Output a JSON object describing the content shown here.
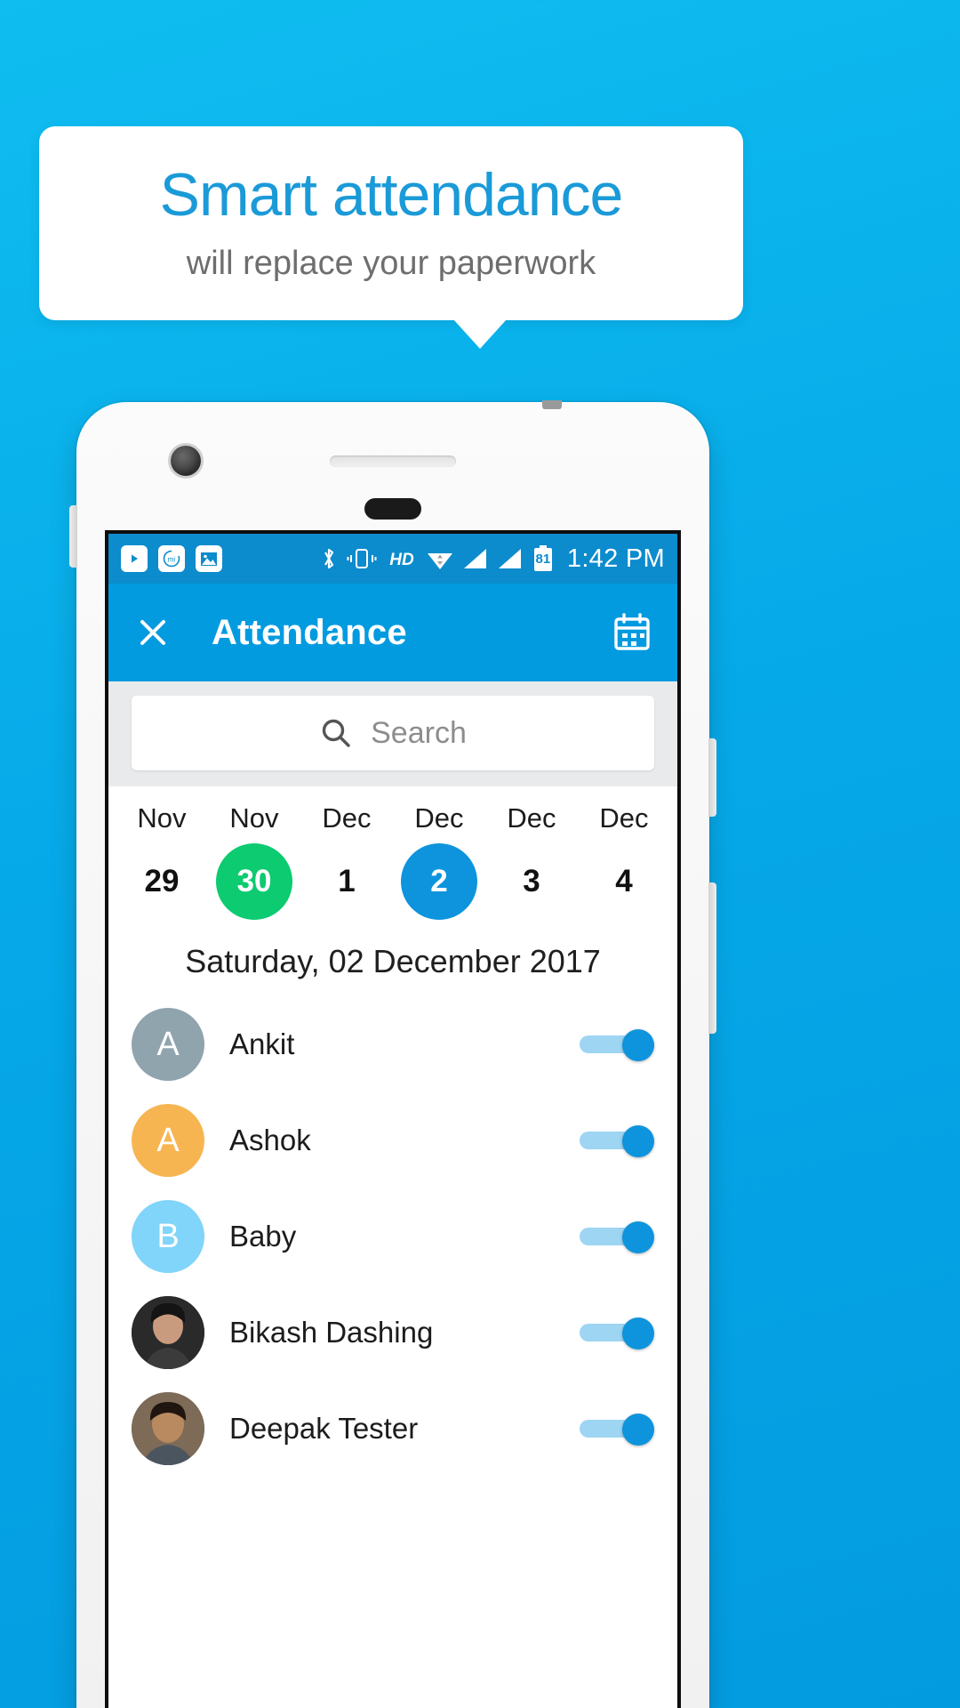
{
  "promo": {
    "title": "Smart attendance",
    "subtitle": "will replace your paperwork",
    "title_color": "#1b9ad8",
    "subtitle_color": "#6e6e6e",
    "background_color": "#06a9e8"
  },
  "statusbar": {
    "time": "1:42 PM",
    "battery_level": "81",
    "left_icons": [
      "youtube-play-icon",
      "mi-app-icon",
      "gallery-image-icon"
    ],
    "right_icons": [
      "bluetooth-icon",
      "vibrate-icon",
      "hd-icon",
      "wifi-icon",
      "signal-sim1-icon",
      "signal-sim2-icon",
      "battery-icon"
    ],
    "background_color": "#0c8bcd"
  },
  "appbar": {
    "title": "Attendance",
    "close_icon": "close-icon",
    "calendar_icon": "calendar-icon",
    "background_color": "#039be0"
  },
  "search": {
    "placeholder": "Search",
    "value": "",
    "icon": "search-icon"
  },
  "date_strip": [
    {
      "month": "Nov",
      "day": "29",
      "state": "normal"
    },
    {
      "month": "Nov",
      "day": "30",
      "state": "today"
    },
    {
      "month": "Dec",
      "day": "1",
      "state": "normal"
    },
    {
      "month": "Dec",
      "day": "2",
      "state": "selected"
    },
    {
      "month": "Dec",
      "day": "3",
      "state": "normal"
    },
    {
      "month": "Dec",
      "day": "4",
      "state": "normal"
    }
  ],
  "date_colors": {
    "today": "#0ccb70",
    "selected": "#0d94dd"
  },
  "selected_day_label": "Saturday, 02 December 2017",
  "attendance": [
    {
      "name": "Ankit",
      "initial": "A",
      "avatar_color": "#90a4ae",
      "avatar_type": "initial",
      "present": true
    },
    {
      "name": "Ashok",
      "initial": "A",
      "avatar_color": "#f5b champ",
      "avatar_type": "initial",
      "present": true
    },
    {
      "name": "Baby",
      "initial": "B",
      "avatar_color": "#81d4fa",
      "avatar_type": "initial",
      "present": true
    },
    {
      "name": "Bikash Dashing",
      "initial": "",
      "avatar_color": "#2b2b2b",
      "avatar_type": "photo",
      "present": true
    },
    {
      "name": "Deepak Tester",
      "initial": "",
      "avatar_color": "#6b5a4a",
      "avatar_type": "photo",
      "present": true
    }
  ],
  "switch_colors": {
    "track": "#9ed5f3",
    "knob": "#0d94dd"
  }
}
